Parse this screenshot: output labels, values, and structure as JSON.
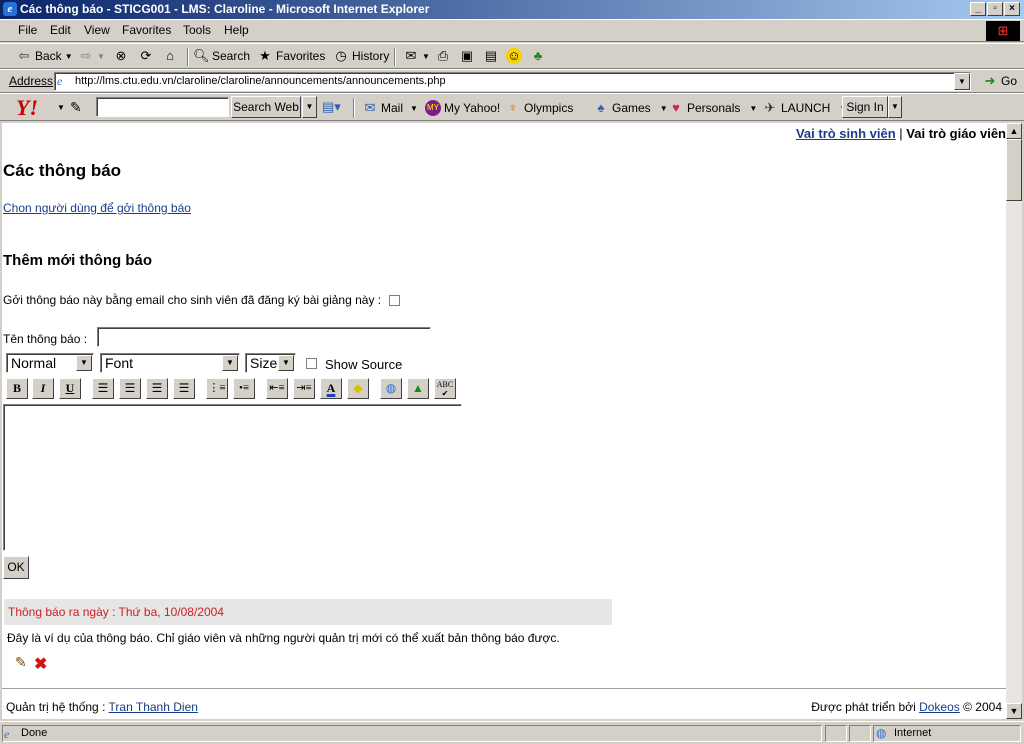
{
  "window": {
    "title": "Các thông báo - STICG001 - LMS: Claroline - Microsoft Internet Explorer"
  },
  "menu": [
    "File",
    "Edit",
    "View",
    "Favorites",
    "Tools",
    "Help"
  ],
  "toolbar": {
    "back": "Back",
    "search": "Search",
    "favorites": "Favorites",
    "history": "History"
  },
  "address": {
    "label": "Address",
    "url": "http://lms.ctu.edu.vn/claroline/claroline/announcements/announcements.php",
    "go": "Go"
  },
  "yahoo": {
    "search_button": "Search Web",
    "mail": "Mail",
    "myyahoo": "My Yahoo!",
    "olympics": "Olympics",
    "games": "Games",
    "personals": "Personals",
    "launch": "LAUNCH",
    "signin": "Sign In"
  },
  "page": {
    "roles": {
      "student": "Vai trò sinh viên",
      "separator": "|",
      "teacher": "Vai trò giáo viên"
    },
    "heading": "Các thông báo",
    "choose_users_link": "Chon người dùng để gởi thông báo",
    "add_heading": "Thêm mới thông báo",
    "email_label": "Gởi thông báo này bằng email cho sinh viên đã đăng ký bài giảng này :",
    "title_label": "Tên thông báo :",
    "title_value": "",
    "editor": {
      "style": "Normal",
      "font": "Font",
      "size": "Size",
      "show_source": "Show Source"
    },
    "ok_button": "OK",
    "announcement": {
      "date": "Thông báo ra ngày : Thứ ba, 10/08/2004",
      "body": "Đây là ví dụ của thông báo. Chỉ giáo viên và những người quản trị mới có thể xuất bản thông báo được."
    },
    "footer": {
      "admin_label": "Quản trị hệ thống :",
      "admin_name": "Tran Thanh Dien",
      "developed_by": "Được phát triển bởi",
      "developer": "Dokeos",
      "copyright": "© 2004"
    }
  },
  "status": {
    "left": "Done",
    "zone": "Internet"
  },
  "colors": {
    "link": "#1a3c8c",
    "announce_date": "#cc2222",
    "announce_bg": "#e6e6e6"
  }
}
